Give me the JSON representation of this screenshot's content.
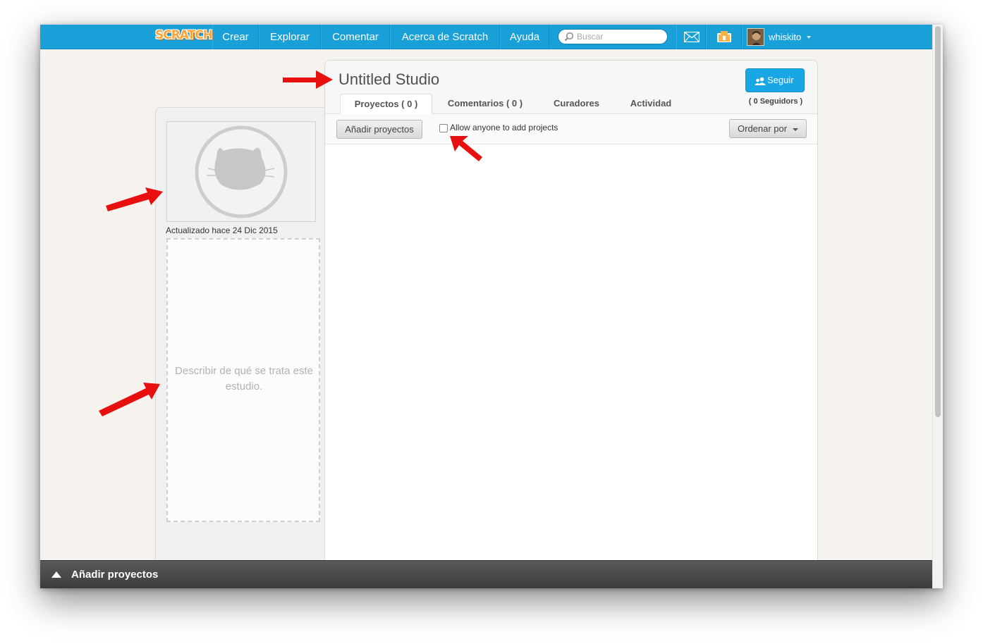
{
  "navbar": {
    "logo": "SCRATCH",
    "items": [
      "Crear",
      "Explorar",
      "Comentar",
      "Acerca de Scratch",
      "Ayuda"
    ],
    "search_placeholder": "Buscar",
    "username": "whiskito"
  },
  "sidebar": {
    "updated": "Actualizado hace 24 Dic 2015",
    "description_placeholder": "Describir de qué se trata este estudio."
  },
  "studio": {
    "title": "Untitled Studio",
    "follow_label": "Seguir",
    "followers": "( 0 Seguidors )",
    "tabs": [
      "Proyectos ( 0 )",
      "Comentarios ( 0 )",
      "Curadores",
      "Actividad"
    ],
    "add_projects_label": "Añadir proyectos",
    "allow_label": "Allow anyone to add projects",
    "sort_label": "Ordenar por"
  },
  "bottom_bar": {
    "label": "Añadir proyectos"
  },
  "colors": {
    "navbar": "#1aa0d8",
    "follow_button": "#19a6e5",
    "annotation_arrow": "#e8100f",
    "page_background": "#f6f3ee"
  }
}
